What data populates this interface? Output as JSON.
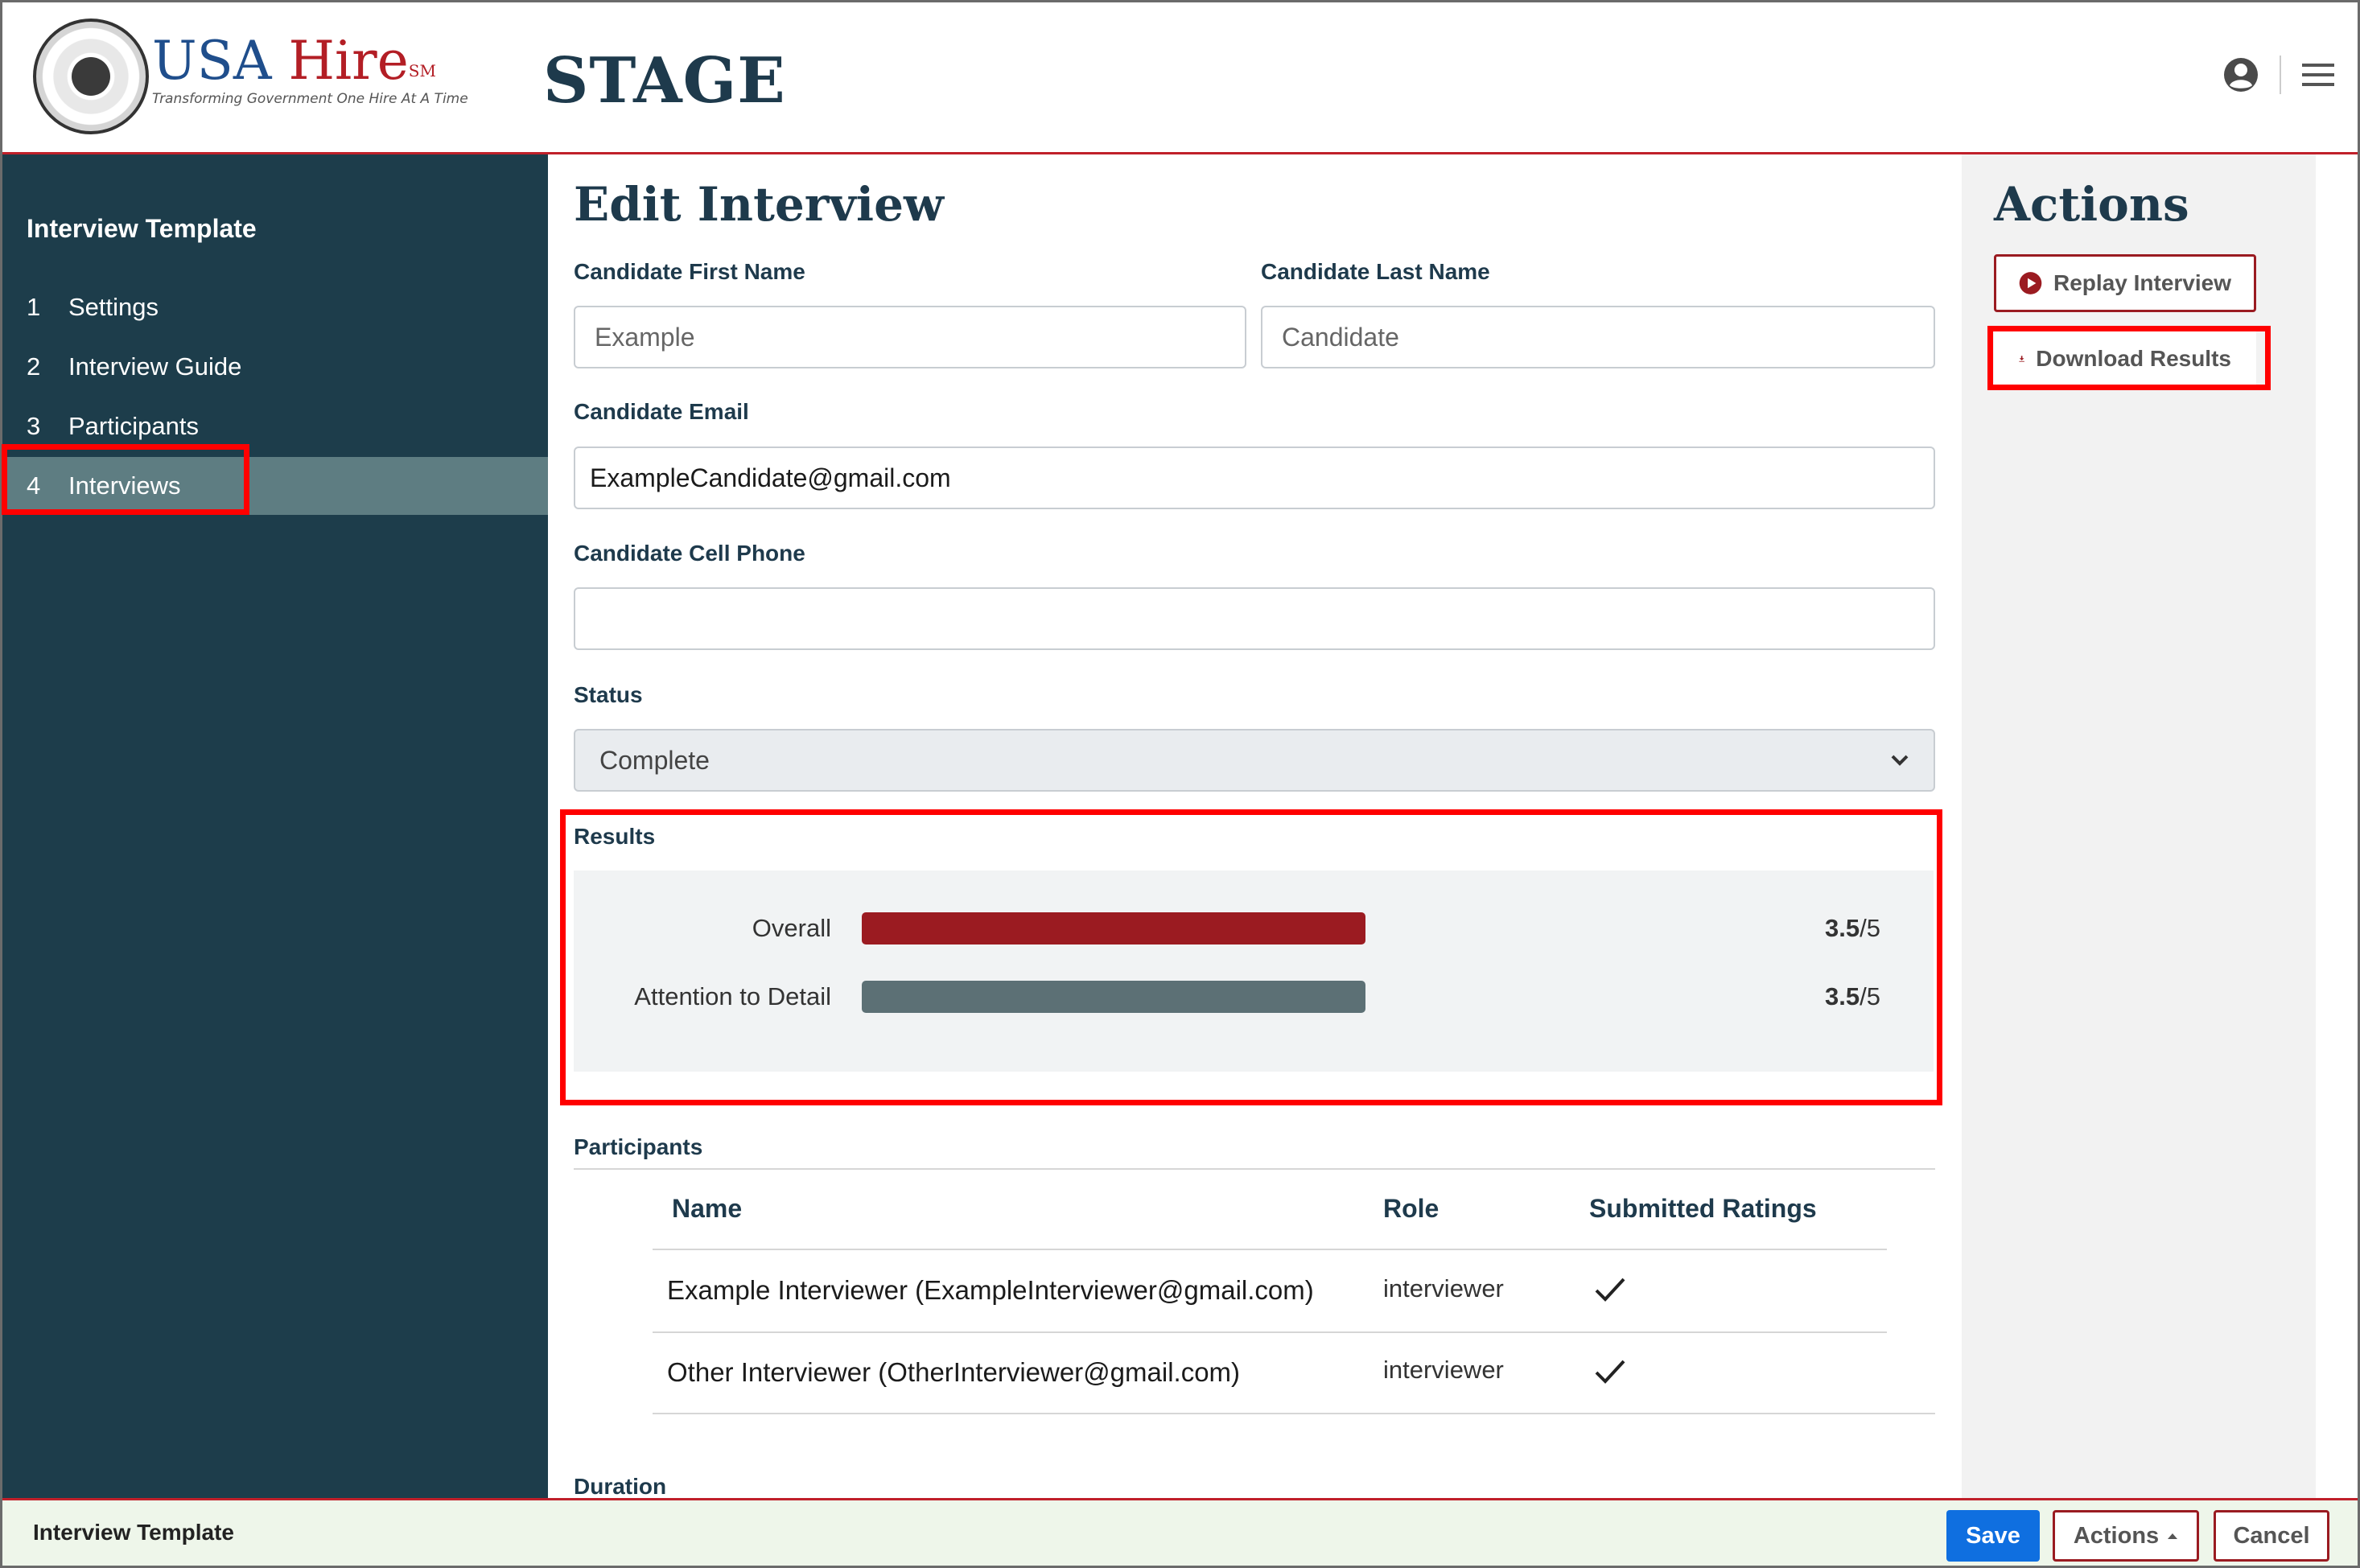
{
  "header": {
    "brand_usa": "USA ",
    "brand_hire": "Hire",
    "brand_sm": "SM",
    "brand_tagline": "Transforming Government One Hire At A Time",
    "environment": "STAGE"
  },
  "sidebar": {
    "title": "Interview Template",
    "items": [
      {
        "num": "1",
        "label": "Settings"
      },
      {
        "num": "2",
        "label": "Interview Guide"
      },
      {
        "num": "3",
        "label": "Participants"
      },
      {
        "num": "4",
        "label": "Interviews"
      }
    ],
    "active_index": 3
  },
  "main": {
    "title": "Edit Interview",
    "first_name_label": "Candidate First Name",
    "first_name_placeholder": "Example",
    "last_name_label": "Candidate Last Name",
    "last_name_placeholder": "Candidate",
    "email_label": "Candidate Email",
    "email_value": "ExampleCandidate@gmail.com",
    "phone_label": "Candidate Cell Phone",
    "phone_value": "",
    "status_label": "Status",
    "status_value": "Complete",
    "results_label": "Results",
    "results": [
      {
        "label": "Overall",
        "score": "3.5",
        "max": "/5",
        "fraction": 0.7,
        "color": "#9b1b21"
      },
      {
        "label": "Attention to Detail",
        "score": "3.5",
        "max": "/5",
        "fraction": 0.7,
        "color": "#5c7075"
      }
    ],
    "participants_label": "Participants",
    "participants_columns": [
      "Name",
      "Role",
      "Submitted Ratings"
    ],
    "participants_rows": [
      {
        "name": "Example Interviewer (ExampleInterviewer@gmail.com)",
        "role": "interviewer",
        "submitted": true
      },
      {
        "name": "Other Interviewer (OtherInterviewer@gmail.com)",
        "role": "interviewer",
        "submitted": true
      }
    ],
    "duration_label": "Duration"
  },
  "actions": {
    "title": "Actions",
    "replay_label": "Replay Interview",
    "download_label": "Download Results"
  },
  "footer": {
    "title": "Interview Template",
    "save_label": "Save",
    "actions_label": "Actions",
    "cancel_label": "Cancel"
  },
  "colors": {
    "sidebar_bg": "#1d3d4b",
    "sidebar_active": "#5e7d82",
    "accent_red": "#9b1b21",
    "primary_blue": "#0f6fe0",
    "highlight_red": "#ff0000"
  },
  "icons": [
    "user-circle-icon",
    "hamburger-menu-icon",
    "play-circle-icon",
    "download-icon",
    "checkmark-icon",
    "chevron-down-icon",
    "caret-up-icon"
  ]
}
